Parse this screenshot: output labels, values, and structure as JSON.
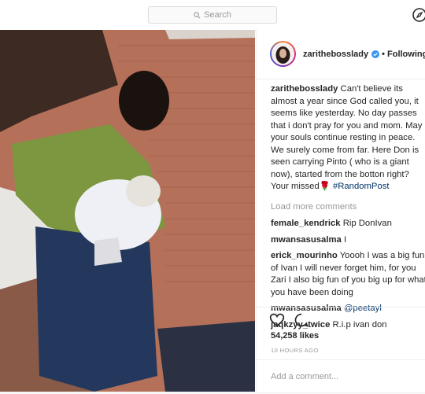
{
  "search": {
    "placeholder": "Search"
  },
  "post": {
    "author": "zarithebosslady",
    "follow_state": "Following",
    "caption": {
      "username": "zarithebosslady",
      "text": "Can't believe its almost a year since God called you, it seems like yesterday. No day passes that i don't pray for you and mom. May your souls continue resting in peace. We surely come from far. Here Don is seen carrying Pinto ( who is a giant now), started from the botton right? Your missed🌹",
      "hashtag": "#RandomPost"
    },
    "load_more": "Load more comments",
    "comments": [
      {
        "username": "female_kendrick",
        "text": "Rip DonIvan"
      },
      {
        "username": "mwansasusalma",
        "text": "I"
      },
      {
        "username": "erick_mourinho",
        "text": "Yoooh I was a big fun of Ivan I will never forget him, for you Zari I also big fun of you big up for what you have been doing"
      },
      {
        "username": "mwansasusalma",
        "text": "@peetayl"
      },
      {
        "username": "jaqkzyy_twice",
        "text": "R.i.p ivan don"
      }
    ],
    "likes": "54,258 likes",
    "time_ago": "10 HOURS AGO",
    "add_comment_placeholder": "Add a comment..."
  },
  "icons": [
    "search-icon",
    "compass-icon",
    "verified-icon",
    "heart-icon",
    "comment-icon"
  ],
  "colors": {
    "link": "#003569",
    "muted": "#999999",
    "verified": "#3897f0"
  }
}
